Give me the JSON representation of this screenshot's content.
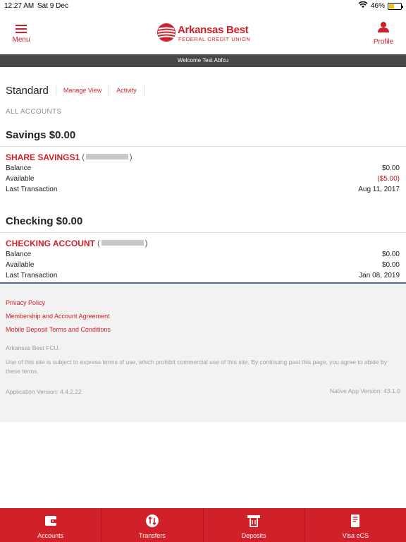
{
  "status": {
    "time": "12:27 AM",
    "date": "Sat 9 Dec",
    "battery": "46%",
    "battery_level": 0.46
  },
  "header": {
    "menu_label": "Menu",
    "profile_label": "Profile",
    "logo_name": "Arkansas Best",
    "logo_sub": "FEDERAL CREDIT UNION"
  },
  "welcome": "Welcome Test Abfcu",
  "view": {
    "title": "Standard",
    "manage": "Manage View",
    "activity": "Activity"
  },
  "all_accounts": "ALL ACCOUNTS",
  "savings": {
    "title": "Savings $0.00",
    "account": {
      "name": "SHARE SAVINGS1",
      "rows": [
        {
          "label": "Balance",
          "value": "$0.00"
        },
        {
          "label": "Available",
          "value": "($5.00)"
        },
        {
          "label": "Last Transaction",
          "value": "Aug 11, 2017"
        }
      ]
    }
  },
  "checking": {
    "title": "Checking $0.00",
    "account": {
      "name": "CHECKING ACCOUNT",
      "rows": [
        {
          "label": "Balance",
          "value": "$0.00"
        },
        {
          "label": "Available",
          "value": "$0.00"
        },
        {
          "label": "Last Transaction",
          "value": "Jan 08, 2019"
        }
      ]
    }
  },
  "footer": {
    "links": [
      "Privacy Policy",
      "Membership and Account Agreement",
      "Mobile Deposit Terms and Conditions"
    ],
    "org": "Arkansas Best FCU.",
    "terms": "Use of this site is subject to express terms of use, which prohibit commercial use of this site. By continuing past this page, you agree to abide by these terms.",
    "app_version": "Application Version: 4.4.2.22",
    "native_version": "Native App Version: 43.1.0"
  },
  "tabs": [
    {
      "label": "Accounts",
      "icon": "wallet-icon"
    },
    {
      "label": "Transfers",
      "icon": "transfer-icon"
    },
    {
      "label": "Deposits",
      "icon": "deposit-icon"
    },
    {
      "label": "Visa eCS",
      "icon": "card-statement-icon"
    }
  ],
  "colors": {
    "brand": "#d0202a",
    "welcome_bar": "#484848",
    "footer_bg": "#f2f2f3"
  }
}
